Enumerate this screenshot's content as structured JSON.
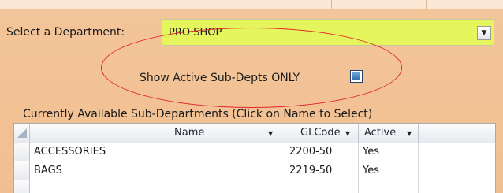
{
  "department": {
    "label": "Select a Department:",
    "value": "PRO SHOP"
  },
  "filter": {
    "label": "Show Active Sub-Depts ONLY",
    "checked": true
  },
  "list": {
    "caption": "Currently Available Sub-Departments (Click on Name to Select)",
    "columns": [
      "Name",
      "GLCode",
      "Active"
    ],
    "rows": [
      {
        "name": "ACCESSORIES",
        "glcode": "2200-50",
        "active": "Yes"
      },
      {
        "name": "BAGS",
        "glcode": "2219-50",
        "active": "Yes"
      }
    ]
  },
  "colors": {
    "panel": "#f2c79a",
    "select_bg": "#e5f55e",
    "annotation": "#e0242a"
  },
  "icons": {
    "dropdown": "chevron-down-icon",
    "sort": "sort-down-arrow-icon",
    "select_all": "select-all-corner-icon"
  }
}
